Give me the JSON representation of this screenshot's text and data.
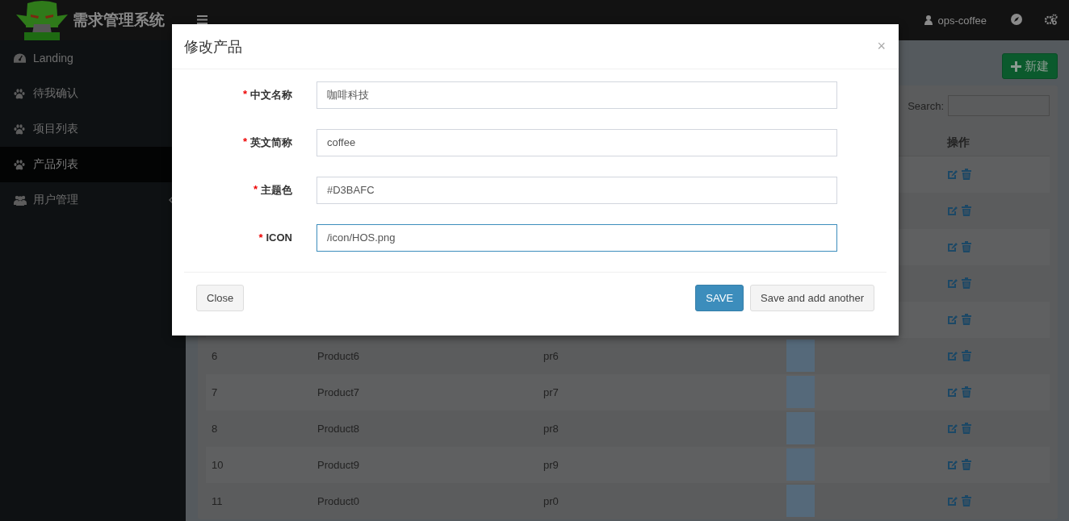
{
  "header": {
    "title": "需求管理系统",
    "user": "ops-coffee"
  },
  "sidebar": {
    "items": [
      {
        "label": "Landing",
        "selected": false,
        "has_children": false
      },
      {
        "label": "待我确认",
        "selected": false,
        "has_children": false
      },
      {
        "label": "项目列表",
        "selected": false,
        "has_children": false
      },
      {
        "label": "产品列表",
        "selected": true,
        "has_children": false
      },
      {
        "label": "用户管理",
        "selected": false,
        "has_children": true
      }
    ]
  },
  "new_button": "新建",
  "search": {
    "label": "Search:"
  },
  "table": {
    "columns": [
      {
        "label": "操作"
      }
    ],
    "rows": [
      {},
      {},
      {},
      {},
      {},
      {
        "id": "6",
        "name": "Product6",
        "code": "pr6"
      },
      {
        "id": "7",
        "name": "Product7",
        "code": "pr7"
      },
      {
        "id": "8",
        "name": "Product8",
        "code": "pr8"
      },
      {
        "id": "10",
        "name": "Product9",
        "code": "pr9"
      },
      {
        "id": "11",
        "name": "Product0",
        "code": "pr0"
      }
    ]
  },
  "modal": {
    "title": "修改产品",
    "close": "×",
    "fields": [
      {
        "required_mark": "*",
        "label": "中文名称",
        "value": "咖啡科技",
        "focused": false
      },
      {
        "required_mark": "*",
        "label": "英文简称",
        "value": "coffee",
        "focused": false
      },
      {
        "required_mark": "*",
        "label": "主题色",
        "value": "#D3BAFC",
        "focused": false
      },
      {
        "required_mark": "*",
        "label": "ICON",
        "value": "/icon/HOS.png",
        "focused": true
      }
    ],
    "buttons": [
      {
        "label": "Close",
        "kind": "default"
      },
      {
        "label": "SAVE",
        "kind": "primary"
      },
      {
        "label": "Save and add another",
        "kind": "default"
      }
    ]
  }
}
